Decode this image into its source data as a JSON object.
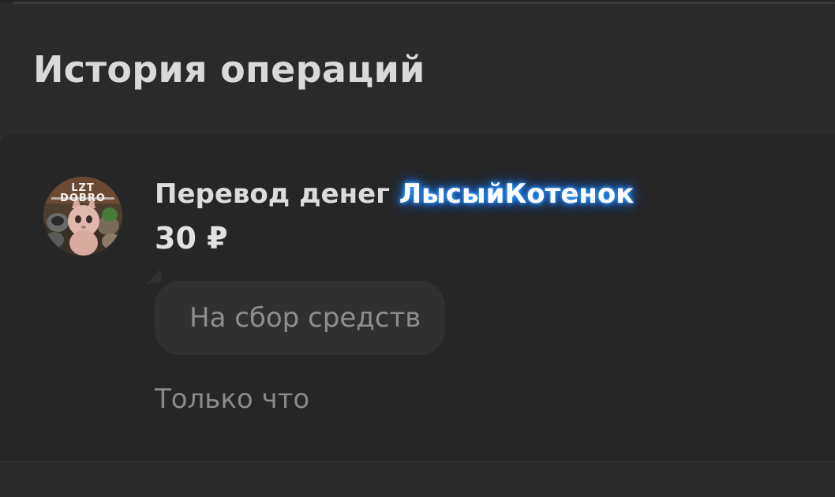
{
  "page": {
    "title": "История операций"
  },
  "transaction": {
    "avatar_label": "LZT DOBRO",
    "avatar_label_line1": "LZT",
    "avatar_label_line2": "DOBRO",
    "title_prefix": "Перевод денег ",
    "username": "ЛысыйКотенок",
    "amount": "30 ₽",
    "comment": "На сбор средств",
    "time": "Только что"
  },
  "colors": {
    "background": "#2c2c2c",
    "card": "#262626",
    "username_glow": "#1f88ff",
    "comment_bubble": "#303030"
  }
}
